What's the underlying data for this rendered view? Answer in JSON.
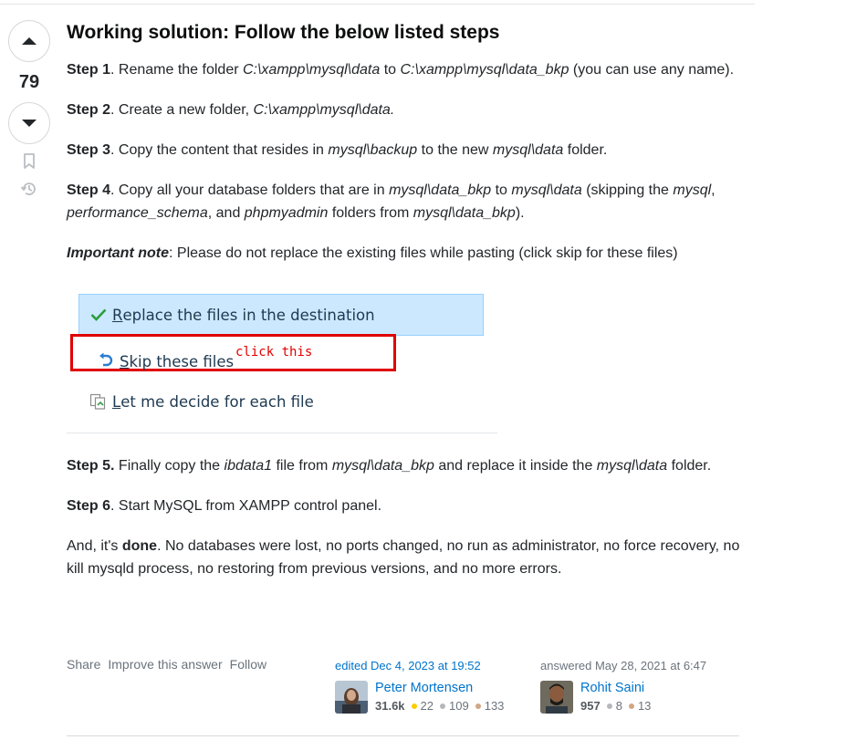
{
  "vote": {
    "count": "79"
  },
  "answer": {
    "title": "Working solution: Follow the below listed steps",
    "step1": {
      "label": "Step 1",
      "t1": ". Rename the folder ",
      "i1": "C:\\xampp\\mysql\\data",
      "t2": " to ",
      "i2": "C:\\xampp\\mysql\\data_bkp",
      "t3": " (you can use any name)."
    },
    "step2": {
      "label": "Step 2",
      "t1": ". Create a new folder, ",
      "i1": "C:\\xampp\\mysql\\data."
    },
    "step3": {
      "label": "Step 3",
      "t1": ". Copy the content that resides in ",
      "i1": "mysql\\backup",
      "t2": " to the new ",
      "i2": "mysql\\data",
      "t3": " folder."
    },
    "step4": {
      "label": "Step 4",
      "t1": ". Copy all your database folders that are in ",
      "i1": "mysql\\data_bkp",
      "t2": " to ",
      "i2": "mysql\\data",
      "t3": " (skipping the ",
      "i3": "mysql",
      "t4": ", ",
      "i4": "performance_schema",
      "t5": ", and ",
      "i5": "phpmyadmin",
      "t6": " folders from ",
      "i6": "mysql\\data_bkp",
      "t7": ")."
    },
    "note": {
      "label": "Important note",
      "text": ": Please do not replace the existing files while pasting (click skip for these files)"
    },
    "dialog": {
      "replace_u": "R",
      "replace_rest": "eplace the files in the destination",
      "skip_u": "S",
      "skip_rest": "kip these files",
      "decide_u": "L",
      "decide_rest": "et me decide for each file",
      "annotation": "click this"
    },
    "step5": {
      "label": "Step 5.",
      "t1": " Finally copy the ",
      "i1": "ibdata1",
      "t2": " file from ",
      "i2": "mysql\\data_bkp",
      "t3": " and replace it inside the ",
      "i3": "mysql\\data",
      "t4": " folder."
    },
    "step6": {
      "label": "Step 6",
      "t1": ". Start MySQL from XAMPP control panel."
    },
    "done": {
      "t1": "And, it's ",
      "b1": "done",
      "t2": ". No databases were lost, no ports changed, no run as administrator, no force recovery, no kill mysqld process, no restoring from previous versions, and no more errors."
    }
  },
  "footer": {
    "menu": [
      "Share",
      "Improve this answer",
      "Follow"
    ],
    "edited": {
      "action": "edited Dec 4, 2023 at 19:52",
      "name": "Peter Mortensen",
      "rep": "31.6k",
      "gold": "22",
      "silver": "109",
      "bronze": "133"
    },
    "answered": {
      "action": "answered May 28, 2021 at 6:47",
      "name": "Rohit Saini",
      "rep": "957",
      "silver": "8",
      "bronze": "13"
    }
  },
  "colors": {
    "link": "#0074cc",
    "accent_red": "#e00000",
    "gold": "#ffcc01",
    "silver": "#b4b8bc",
    "bronze": "#d1a684"
  }
}
